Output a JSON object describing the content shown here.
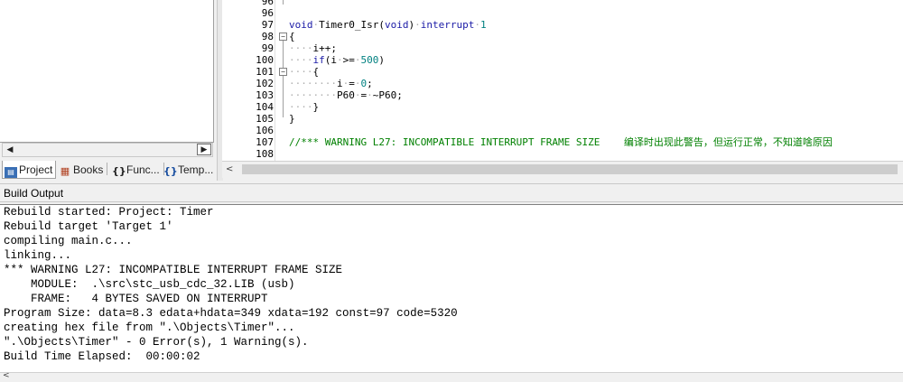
{
  "project_pane": {
    "tabs": [
      {
        "label": "Project",
        "icon": "project-icon",
        "active": true
      },
      {
        "label": "Books",
        "icon": "books-icon",
        "active": false
      },
      {
        "label": "Func...",
        "icon": "functions-icon",
        "active": false
      },
      {
        "label": "Temp...",
        "icon": "templates-icon",
        "active": false
      }
    ],
    "scroll_left_glyph": "◀",
    "scroll_right_glyph": "▶"
  },
  "editor": {
    "lines": [
      {
        "num": "96",
        "text": ""
      },
      {
        "num": "97",
        "text": "void Timer0_Isr(void) interrupt 1"
      },
      {
        "num": "98",
        "text": "{"
      },
      {
        "num": "99",
        "text": "    i++;"
      },
      {
        "num": "100",
        "text": "    if(i >= 500)"
      },
      {
        "num": "101",
        "text": "    {"
      },
      {
        "num": "102",
        "text": "        i = 0;"
      },
      {
        "num": "103",
        "text": "        P60 = ~P60;"
      },
      {
        "num": "104",
        "text": "    }"
      },
      {
        "num": "105",
        "text": "}"
      },
      {
        "num": "106",
        "text": ""
      },
      {
        "num": "107",
        "text": "//*** WARNING L27: INCOMPATIBLE INTERRUPT FRAME SIZE    编译时出现此警告，但运行正常，不知道啥原因"
      },
      {
        "num": "108",
        "text": ""
      }
    ],
    "scroll_left_glyph": "<"
  },
  "build_output": {
    "title": "Build Output",
    "lines": [
      "Rebuild started: Project: Timer",
      "Rebuild target 'Target 1'",
      "compiling main.c...",
      "linking...",
      "*** WARNING L27: INCOMPATIBLE INTERRUPT FRAME SIZE",
      "    MODULE:  .\\src\\stc_usb_cdc_32.LIB (usb)",
      "    FRAME:   4 BYTES SAVED ON INTERRUPT",
      "Program Size: data=8.3 edata+hdata=349 xdata=192 const=97 code=5320",
      "creating hex file from \".\\Objects\\Timer\"...",
      "\".\\Objects\\Timer\" - 0 Error(s), 1 Warning(s).",
      "Build Time Elapsed:  00:00:02"
    ],
    "scroll_left_glyph": "<"
  },
  "colors": {
    "keyword": "#1a1aa6",
    "number": "#008080",
    "comment": "#008000"
  }
}
